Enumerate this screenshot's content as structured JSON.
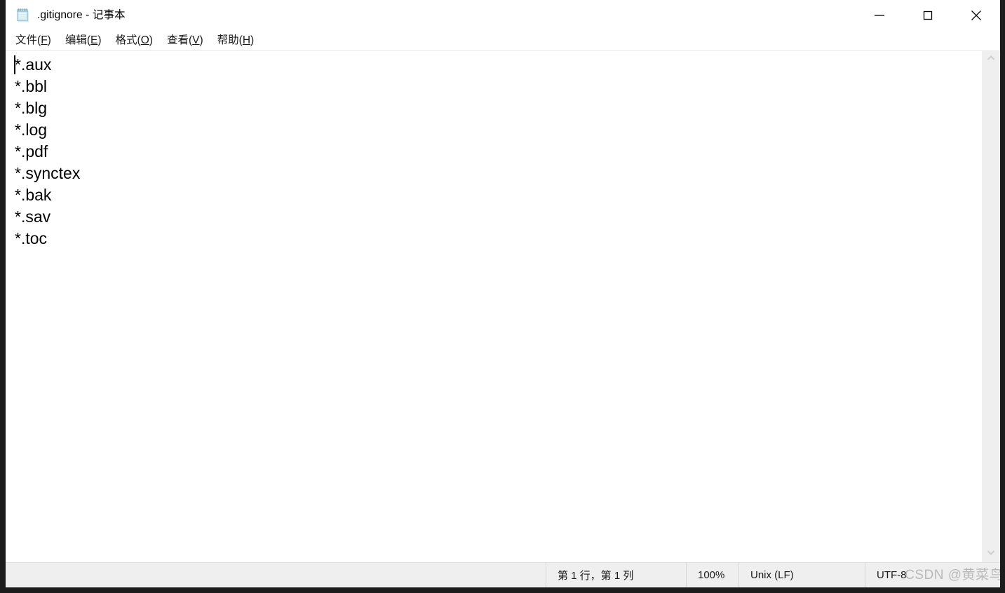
{
  "window": {
    "title": ".gitignore - 记事本",
    "icon": "notepad-icon",
    "controls": [
      {
        "name": "minimize-button",
        "glyph": "minimize-icon",
        "label": "最小化"
      },
      {
        "name": "maximize-button",
        "glyph": "maximize-icon",
        "label": "最大化"
      },
      {
        "name": "close-button",
        "glyph": "close-icon",
        "label": "关闭"
      }
    ]
  },
  "menubar": {
    "items": [
      {
        "name": "menu-file",
        "text": "文件",
        "accel": "F"
      },
      {
        "name": "menu-edit",
        "text": "编辑",
        "accel": "E"
      },
      {
        "name": "menu-format",
        "text": "格式",
        "accel": "O"
      },
      {
        "name": "menu-view",
        "text": "查看",
        "accel": "V"
      },
      {
        "name": "menu-help",
        "text": "帮助",
        "accel": "H"
      }
    ]
  },
  "editor": {
    "lines": [
      "*.aux",
      "*.bbl",
      "*.blg",
      "*.log",
      "*.pdf",
      "*.synctex",
      "*.bak",
      "*.sav",
      "*.toc"
    ],
    "caret_line": 1,
    "caret_column": 1
  },
  "scrollbar": {
    "up_arrow": "chevron-up-icon",
    "down_arrow": "chevron-down-icon"
  },
  "statusbar": {
    "position": "第 1 行，第 1 列",
    "zoom": "100%",
    "line_ending": "Unix (LF)",
    "encoding": "UTF-8"
  },
  "watermark": {
    "text": "CSDN @黄菜鸟"
  },
  "colors": {
    "window_bg": "#ffffff",
    "desktop_bg": "#1c1c1c",
    "statusbar_bg": "#efefef",
    "scrollbar_bg": "#efefef",
    "text": "#000000",
    "watermark": "#b9b9b9"
  }
}
